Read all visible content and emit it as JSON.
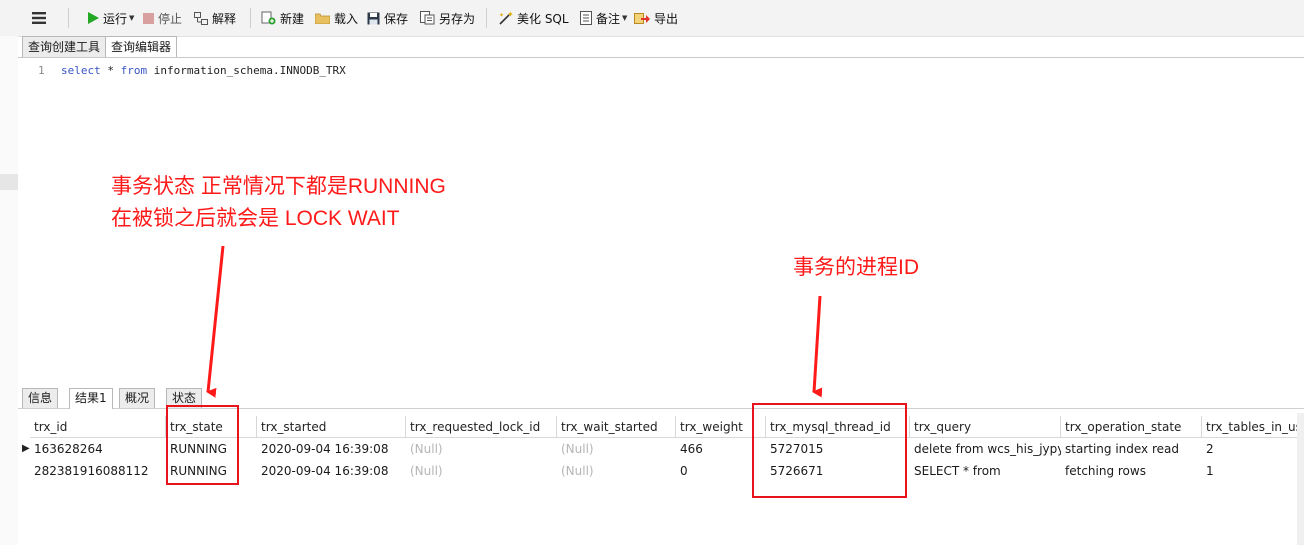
{
  "toolbar": {
    "menu_icon": "hamburger-icon",
    "run": "运行",
    "stop": "停止",
    "explain": "解释",
    "new": "新建",
    "load": "载入",
    "save": "保存",
    "save_as": "另存为",
    "beautify": "美化 SQL",
    "notes": "备注",
    "export": "导出"
  },
  "editor_tabs": [
    "查询创建工具",
    "查询编辑器"
  ],
  "editor": {
    "line_number": "1",
    "kw_select": "select",
    "star": "*",
    "kw_from": "from",
    "table": "information_schema.INNODB_TRX"
  },
  "annotations": {
    "state_line1": "事务状态 正常情况下都是RUNNING",
    "state_line2": "在被锁之后就会是 LOCK WAIT",
    "thread_note": "事务的进程ID"
  },
  "result_tabs": [
    "信息",
    "结果1",
    "概况",
    "状态"
  ],
  "table": {
    "columns": [
      "trx_id",
      "trx_state",
      "trx_started",
      "trx_requested_lock_id",
      "trx_wait_started",
      "trx_weight",
      "trx_mysql_thread_id",
      "trx_query",
      "trx_operation_state",
      "trx_tables_in_use"
    ],
    "rows": [
      [
        "163628264",
        "RUNNING",
        "2020-09-04 16:39:08",
        "(Null)",
        "(Null)",
        "466",
        "5727015",
        "delete from wcs_his_jypyjc",
        "starting index read",
        "2"
      ],
      [
        "282381916088112",
        "RUNNING",
        "2020-09-04 16:39:08",
        "(Null)",
        "(Null)",
        "0",
        "5726671",
        "SELECT       *        from",
        "fetching rows",
        "1"
      ]
    ]
  },
  "colors": {
    "annotation": "#ff1a1a",
    "keyword": "#3a55c6",
    "null_text": "#b5b5b5"
  }
}
